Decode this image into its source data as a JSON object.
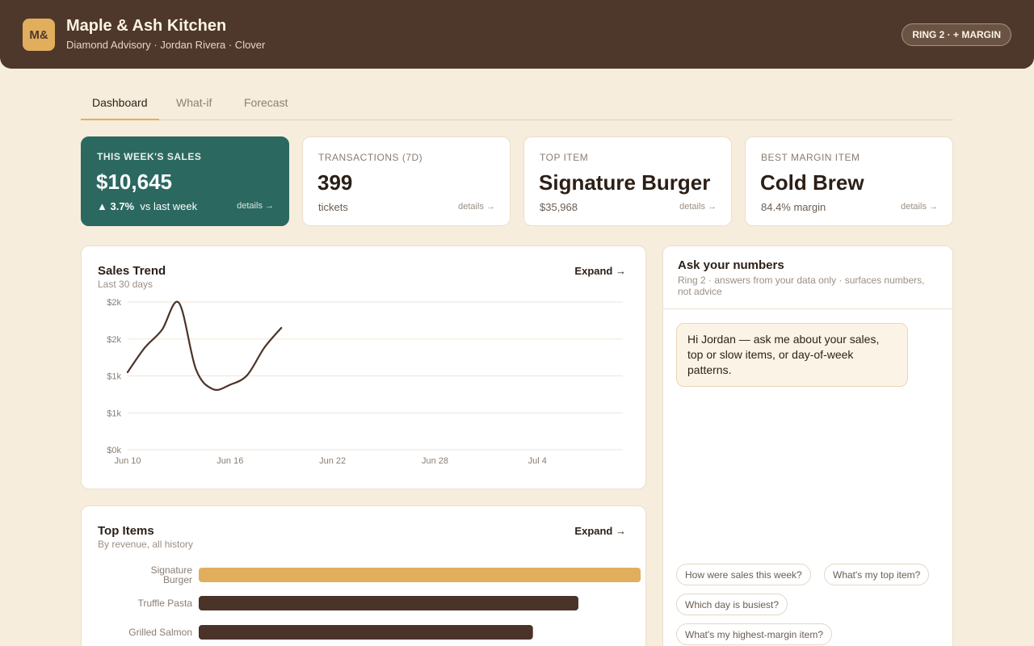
{
  "header": {
    "logo": "M&",
    "business_name": "Maple & Ash Kitchen",
    "subtitle": "Diamond Advisory · Jordan Rivera · Clover",
    "ring_badge": "RING 2 · + MARGIN"
  },
  "tabs": [
    {
      "label": "Dashboard",
      "active": true
    },
    {
      "label": "What-if",
      "active": false
    },
    {
      "label": "Forecast",
      "active": false
    }
  ],
  "kpis": [
    {
      "label": "THIS WEEK'S SALES",
      "value": "$10,645",
      "change": "▲ 3.7%",
      "change_suffix": "vs last week",
      "details": "details →"
    },
    {
      "label": "TRANSACTIONS (7D)",
      "value": "399",
      "sub": "tickets",
      "details": "details →"
    },
    {
      "label": "TOP ITEM",
      "value": "Signature Burger",
      "sub": "$35,968",
      "details": "details →"
    },
    {
      "label": "BEST MARGIN ITEM",
      "value": "Cold Brew",
      "sub": "84.4% margin",
      "details": "details →"
    }
  ],
  "sales_trend": {
    "title": "Sales Trend",
    "subtitle": "Last 30 days",
    "expand": "Expand →"
  },
  "top_items": {
    "title": "Top Items",
    "subtitle": "By revenue, all history",
    "expand": "Expand →"
  },
  "chat": {
    "title": "Ask your numbers",
    "subtitle": "Ring 2 · answers from your data only · surfaces numbers, not advice",
    "greeting": "Hi Jordan — ask me about your sales, top or slow items, or day-of-week patterns.",
    "suggestions": [
      "How were sales this week?",
      "What's my top item?",
      "Which day is busiest?",
      "What's my highest-margin item?"
    ]
  },
  "colors": {
    "header_bg": "#4e372b",
    "accent": "#e1ae5e",
    "green": "#2b6860",
    "bar_dark": "#4a3328"
  },
  "chart_data": [
    {
      "type": "line",
      "ytick_labels": [
        "$0k",
        "$1k",
        "$1k",
        "$2k",
        "$2k"
      ],
      "ytick_values": [
        0,
        500,
        1000,
        1500,
        2000
      ],
      "ylim": [
        0,
        2000
      ],
      "xtick_labels": [
        "Jun 10",
        "Jun 16",
        "Jun 22",
        "Jun 28",
        "Jul 4"
      ],
      "xtick_values": [
        0,
        6,
        12,
        18,
        24
      ],
      "xlim": [
        0,
        29
      ],
      "grid": true,
      "series": [
        {
          "x": [
            0,
            1,
            2,
            3,
            4,
            5,
            6,
            7,
            8,
            9
          ],
          "y": [
            1050,
            1380,
            1620,
            1990,
            1090,
            820,
            880,
            1010,
            1380,
            1650
          ]
        }
      ]
    },
    {
      "type": "bar",
      "orientation": "horizontal",
      "categories": [
        [
          "Signature",
          "Burger"
        ],
        [
          "Truffle Pasta"
        ],
        [
          "Grilled Salmon"
        ]
      ],
      "values": [
        35968,
        30900,
        27200
      ],
      "xlim": [
        0,
        38000
      ]
    }
  ]
}
